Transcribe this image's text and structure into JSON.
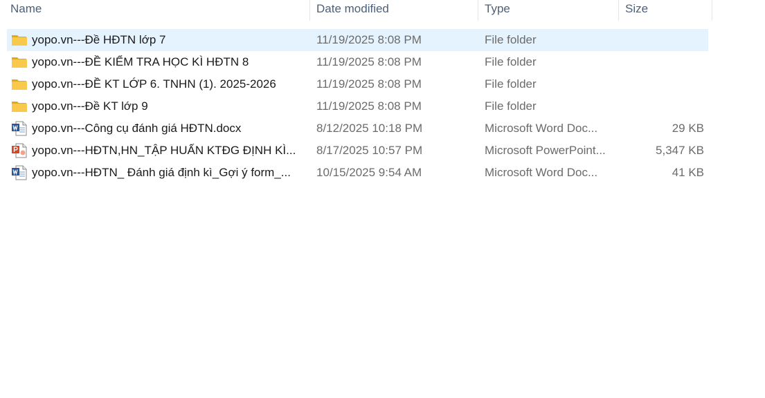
{
  "columns": {
    "name": "Name",
    "date": "Date modified",
    "type": "Type",
    "size": "Size"
  },
  "files": [
    {
      "icon": "folder-icon",
      "name": "yopo.vn---Đề HĐTN lớp 7",
      "date": "11/19/2025 8:08 PM",
      "type": "File folder",
      "size": "",
      "selected": true
    },
    {
      "icon": "folder-icon",
      "name": "yopo.vn---ĐỀ KIỂM TRA HỌC KÌ HĐTN 8",
      "date": "11/19/2025 8:08 PM",
      "type": "File folder",
      "size": ""
    },
    {
      "icon": "folder-icon",
      "name": "yopo.vn---ĐỀ KT LỚP 6. TNHN (1). 2025-2026",
      "date": "11/19/2025 8:08 PM",
      "type": "File folder",
      "size": ""
    },
    {
      "icon": "folder-icon",
      "name": "yopo.vn---Đề KT lớp 9",
      "date": "11/19/2025 8:08 PM",
      "type": "File folder",
      "size": ""
    },
    {
      "icon": "word-document-icon",
      "name": "yopo.vn---Công cụ đánh giá HĐTN.docx",
      "date": "8/12/2025 10:18 PM",
      "type": "Microsoft Word Doc...",
      "size": "29 KB"
    },
    {
      "icon": "powerpoint-document-icon",
      "name": "yopo.vn---HĐTN,HN_TẬP HUẤN KTĐG ĐỊNH KÌ...",
      "date": "8/17/2025 10:57 PM",
      "type": "Microsoft PowerPoint...",
      "size": "5,347 KB"
    },
    {
      "icon": "word-document-icon",
      "name": "yopo.vn---HĐTN_ Đánh giá định kì_Gợi ý form_...",
      "date": "10/15/2025 9:54 AM",
      "type": "Microsoft Word Doc...",
      "size": "41 KB"
    }
  ],
  "colors": {
    "selection": "#e5f3ff",
    "folder": "#f8c94a",
    "word": "#2b579a",
    "powerpoint": "#d24726"
  }
}
